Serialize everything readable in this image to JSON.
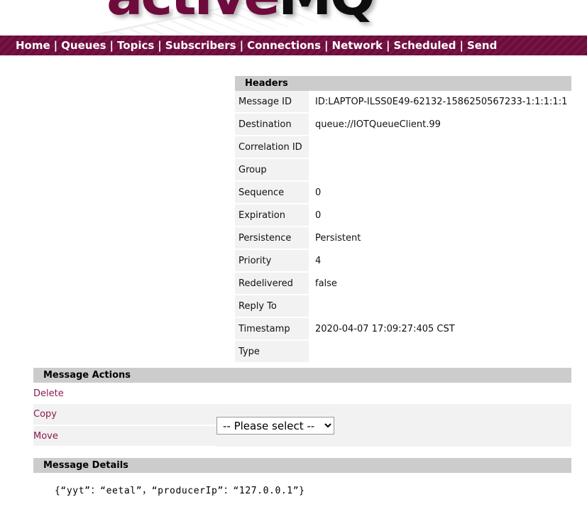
{
  "logo": {
    "text_primary": "active",
    "text_secondary": "MQ"
  },
  "nav": {
    "separator": "|",
    "items": [
      {
        "label": "Home"
      },
      {
        "label": "Queues"
      },
      {
        "label": "Topics"
      },
      {
        "label": "Subscribers"
      },
      {
        "label": "Connections"
      },
      {
        "label": "Network"
      },
      {
        "label": "Scheduled"
      },
      {
        "label": "Send"
      }
    ]
  },
  "headers_panel": {
    "title": "Headers",
    "rows": [
      {
        "label": "Message ID",
        "value": "ID:LAPTOP-ILSS0E49-62132-1586250567233-1:1:1:1:1"
      },
      {
        "label": "Destination",
        "value": "queue://IOTQueueClient.99"
      },
      {
        "label": "Correlation ID",
        "value": ""
      },
      {
        "label": "Group",
        "value": ""
      },
      {
        "label": "Sequence",
        "value": "0"
      },
      {
        "label": "Expiration",
        "value": "0"
      },
      {
        "label": "Persistence",
        "value": "Persistent"
      },
      {
        "label": "Priority",
        "value": "4"
      },
      {
        "label": "Redelivered",
        "value": "false"
      },
      {
        "label": "Reply To",
        "value": ""
      },
      {
        "label": "Timestamp",
        "value": "2020-04-07 17:09:27:405 CST"
      },
      {
        "label": "Type",
        "value": ""
      }
    ]
  },
  "actions_panel": {
    "title": "Message Actions",
    "delete_label": "Delete",
    "copy_label": "Copy",
    "move_label": "Move",
    "select": {
      "selected": "-- Please select --",
      "options": [
        "-- Please select --"
      ]
    }
  },
  "details_panel": {
    "title": "Message Details",
    "body": "{“yyt”：“eetal”，“producerIp”：“127.0.0.1”}"
  },
  "colors": {
    "brand_maroon": "#6e0b3c",
    "link_maroon": "#8a1b4e",
    "panel_header_grey": "#cccccc",
    "cell_grey": "#f2f2f2"
  }
}
